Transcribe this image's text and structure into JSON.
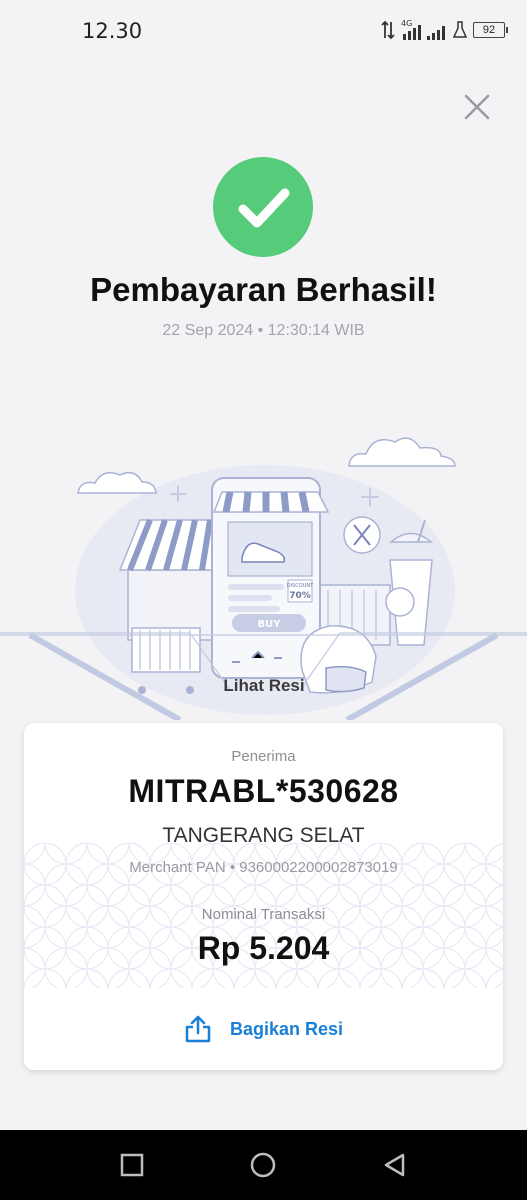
{
  "status_bar": {
    "time": "12.30",
    "network": "4G",
    "battery": "92"
  },
  "header": {
    "title": "Pembayaran Berhasil!",
    "datetime": "22 Sep 2024 • 12:30:14 WIB"
  },
  "illustration": {
    "discount": "70%",
    "discount_label": "DISCOUNT",
    "buy_label": "BUY"
  },
  "receipt_link": "Lihat Resi",
  "card": {
    "recipient_label": "Penerima",
    "recipient_name": "MITRABL*530628",
    "recipient_city": "TANGERANG SELAT",
    "merchant_pan": "Merchant PAN • 9360002200002873019",
    "amount_label": "Nominal Transaksi",
    "amount": "Rp 5.204",
    "share_label": "Bagikan Resi"
  },
  "colors": {
    "success": "#56cc7b",
    "link": "#1a7fd6",
    "background": "#f3f3f5"
  },
  "icons": {
    "close": "close-icon",
    "success": "check-icon",
    "share": "share-icon",
    "nav": [
      "square-recents-icon",
      "circle-home-icon",
      "triangle-back-icon"
    ]
  }
}
